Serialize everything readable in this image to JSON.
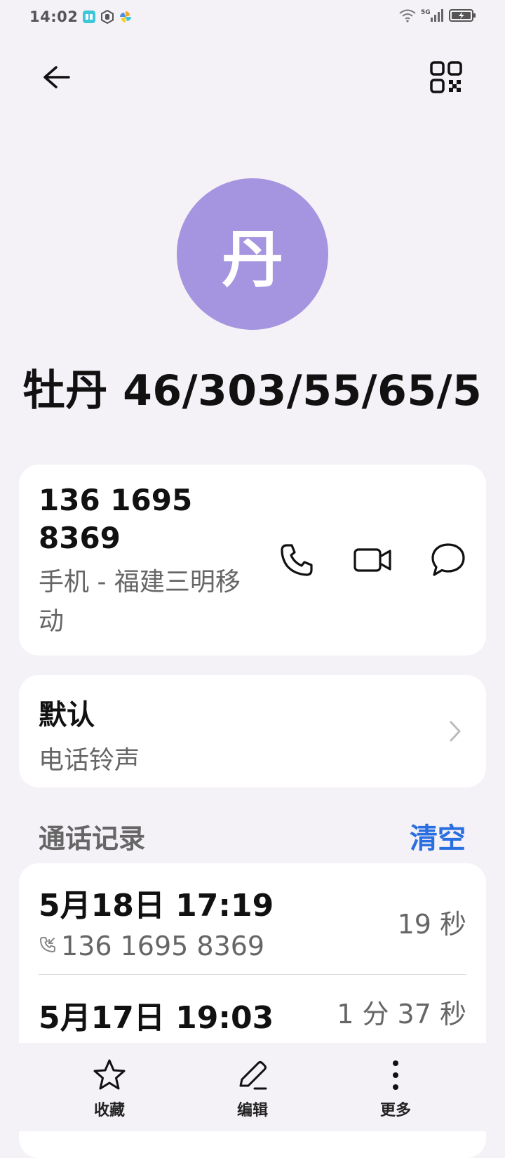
{
  "status_bar": {
    "time": "14:02",
    "network": "5G"
  },
  "header": {
    "back_icon": "arrow-left-icon",
    "qr_icon": "qr-code-icon"
  },
  "contact": {
    "avatar_letter": "丹",
    "avatar_color": "#a595e0",
    "name": "牡丹 46/303/55/65/5"
  },
  "phone": {
    "number": "136 1695 8369",
    "meta": "手机 - 福建三明移动"
  },
  "ringtone": {
    "title": "默认",
    "subtitle": "电话铃声"
  },
  "call_log": {
    "title": "通话记录",
    "clear_label": "清空",
    "accent_color": "#2a6fe0",
    "entries": [
      {
        "date": "5月18日 17:19",
        "number": "136 1695 8369",
        "duration": "19 秒"
      },
      {
        "date": "5月17日 19:03",
        "number": "",
        "duration": "1 分 37 秒"
      }
    ]
  },
  "bottom_bar": {
    "favorite_label": "收藏",
    "edit_label": "编辑",
    "more_label": "更多"
  }
}
